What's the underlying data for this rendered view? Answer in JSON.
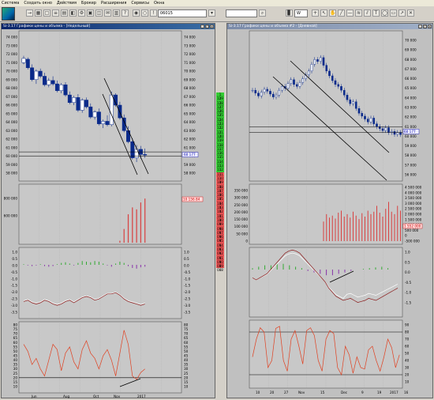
{
  "menu": [
    "Система",
    "Создать окно",
    "Действия",
    "Брокер",
    "Расширения",
    "Сервисы",
    "Окна"
  ],
  "toolbar": {
    "symbol": "06015",
    "period": "W"
  },
  "left": {
    "title": "Si-3.17 Графики цены и объема - [Недельный]",
    "price_ticks": [
      "74 000",
      "73 000",
      "72 000",
      "71 000",
      "70 000",
      "69 000",
      "68 000",
      "67 000",
      "66 000",
      "65 000",
      "64 000",
      "63 000",
      "62 000",
      "61 000",
      "60 000",
      "59 000",
      "58 000"
    ],
    "price_label": "60 177",
    "vol_ticks_left": [
      "800 000",
      "600 000"
    ],
    "vol_ticks_right": [
      "5 000 000"
    ],
    "vol_label": "10 156 84",
    "macd_ticks": [
      "1.0",
      "0.5",
      "0.0",
      "-0.5",
      "-1.0",
      "-1.5",
      "-2.0",
      "-2.5",
      "-3.0",
      "-3.5"
    ],
    "stoch_ticks": [
      "80",
      "75",
      "70",
      "65",
      "60",
      "55",
      "50",
      "45",
      "40",
      "35",
      "30",
      "25",
      "20",
      "15",
      "10"
    ],
    "stoch_ticks_left": [
      "80",
      "75",
      "70",
      "65",
      "60",
      "55",
      "50",
      "45",
      "40",
      "35",
      "30",
      "25",
      "20",
      "15",
      "10"
    ],
    "x_labels": [
      "Jun",
      "Aug",
      "Oct",
      "Nov",
      "2017"
    ]
  },
  "right": {
    "title": "Si-3.17 Графики цены и объема #2 - [Дневной]",
    "price_ticks": [
      "70 000",
      "69 000",
      "68 000",
      "67 000",
      "66 000",
      "65 000",
      "64 000",
      "63 000",
      "62 000",
      "61 000",
      "60 000",
      "59 000",
      "58 000",
      "57 000",
      "56 000"
    ],
    "price_label": "60 177",
    "vol_ticks_left": [
      "350 000",
      "300 000",
      "250 000",
      "200 000",
      "150 000",
      "100 000",
      "50 000",
      "0"
    ],
    "vol_ticks_right": [
      "4 500 000",
      "4 000 000",
      "3 500 000",
      "3 000 000",
      "2 500 000",
      "2 000 000",
      "1 500 000",
      "1 000 000",
      "500 000",
      "0",
      "-500 000"
    ],
    "vol_label": "1 552 000",
    "macd_ticks": [
      "1.0",
      "0.5",
      "0.0",
      "-0.5",
      "-1.0",
      "-1.5"
    ],
    "stoch_ticks": [
      "90",
      "80",
      "70",
      "60",
      "50",
      "40",
      "30",
      "20",
      "10"
    ],
    "x_labels": [
      "10",
      "20",
      "27",
      "Nov",
      "15",
      "Dec",
      "9",
      "19",
      "2017",
      "16"
    ]
  },
  "middle_quotes": {
    "buy": [
      "1 129",
      "1 128",
      "1 127",
      "1 126",
      "1 125",
      "1 124",
      "1 123",
      "1 122",
      "1 121",
      "1 120",
      "1 119",
      "1 118",
      "1 117",
      "1 116",
      "1 115",
      "1 114",
      "1 113",
      "1 112",
      "1 111"
    ],
    "sell": [
      "1 110",
      "1 109",
      "1 108",
      "1 107",
      "1 106",
      "1 105",
      "1 104",
      "1 103",
      "1 102",
      "1 101",
      "1 100",
      "1 099",
      "1 098",
      "1 097",
      "1 096",
      "1 095",
      "1 094",
      "1 093",
      "1 092",
      "1 091",
      "1 090",
      "1 089",
      "1 088"
    ]
  },
  "colors": {
    "candle": "#0a2a8a",
    "volume": "#d84040",
    "macd_line": "#8a1a1a",
    "signal_line": "#ffffff",
    "stoch": "#e04020",
    "buy": "#3c3",
    "sell": "#e55"
  }
}
